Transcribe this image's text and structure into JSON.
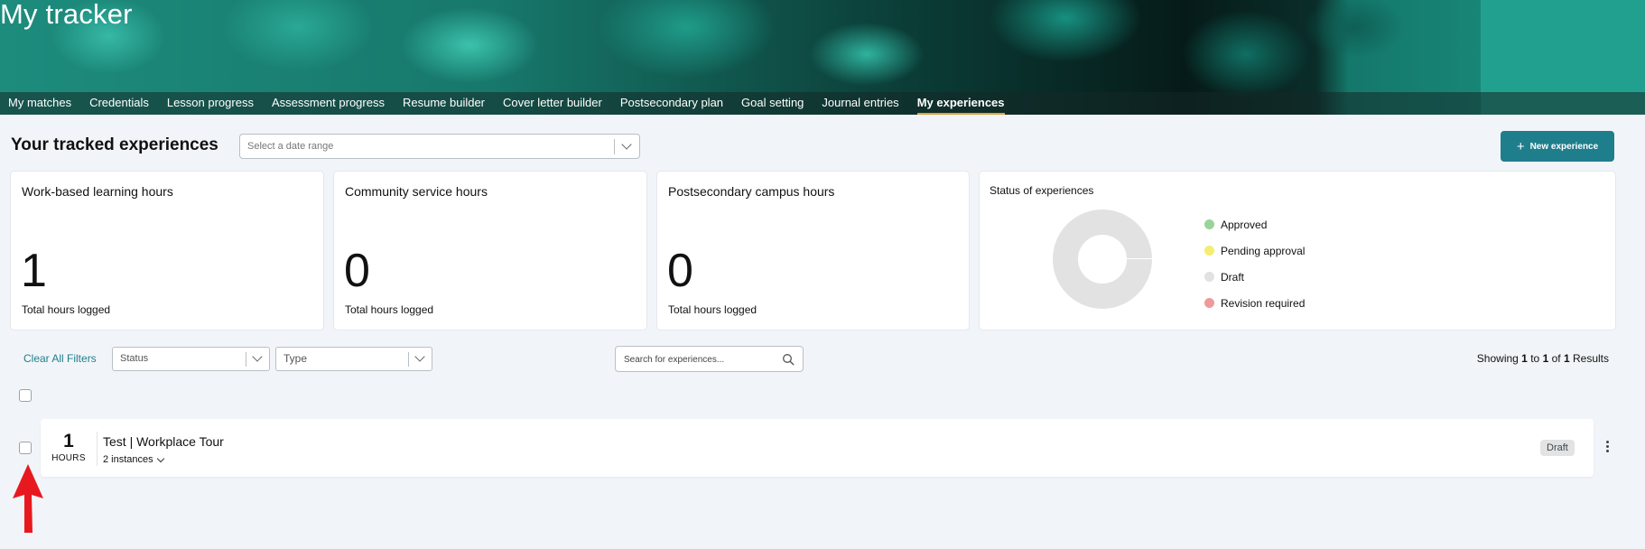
{
  "header": {
    "title": "My tracker",
    "tabs": [
      {
        "label": "My matches",
        "active": false
      },
      {
        "label": "Credentials",
        "active": false
      },
      {
        "label": "Lesson progress",
        "active": false
      },
      {
        "label": "Assessment progress",
        "active": false
      },
      {
        "label": "Resume builder",
        "active": false
      },
      {
        "label": "Cover letter builder",
        "active": false
      },
      {
        "label": "Postsecondary plan",
        "active": false
      },
      {
        "label": "Goal setting",
        "active": false
      },
      {
        "label": "Journal entries",
        "active": false
      },
      {
        "label": "My experiences",
        "active": true
      }
    ]
  },
  "toolbar": {
    "page_title": "Your tracked experiences",
    "date_range_placeholder": "Select a date range",
    "new_button_label": "New experience"
  },
  "stats": [
    {
      "title": "Work-based learning hours",
      "value": "1",
      "subtitle": "Total hours logged"
    },
    {
      "title": "Community service hours",
      "value": "0",
      "subtitle": "Total hours logged"
    },
    {
      "title": "Postsecondary campus hours",
      "value": "0",
      "subtitle": "Total hours logged"
    }
  ],
  "status_card": {
    "title": "Status of experiences",
    "legend": [
      {
        "label": "Approved",
        "color": "#9bd39a"
      },
      {
        "label": "Pending approval",
        "color": "#f3ee6f"
      },
      {
        "label": "Draft",
        "color": "#e2e2e2"
      },
      {
        "label": "Revision required",
        "color": "#ef9a9a"
      }
    ],
    "donut_color": "#e2e2e2"
  },
  "filters": {
    "clear_label": "Clear All Filters",
    "status_placeholder": "Status",
    "type_placeholder": "Type",
    "search_placeholder": "Search for experiences...",
    "results": {
      "prefix": "Showing",
      "from": "1",
      "to_word": "to",
      "to": "1",
      "of_word": "of",
      "total": "1",
      "suffix": "Results"
    }
  },
  "experiences": [
    {
      "hours": "1",
      "hours_label": "HOURS",
      "title": "Test | Workplace Tour",
      "instances": "2 instances",
      "status": "Draft"
    }
  ],
  "colors": {
    "accent": "#1f7e8c",
    "active_tab_underline": "#e0a33a",
    "arrow": "#e8191e"
  }
}
